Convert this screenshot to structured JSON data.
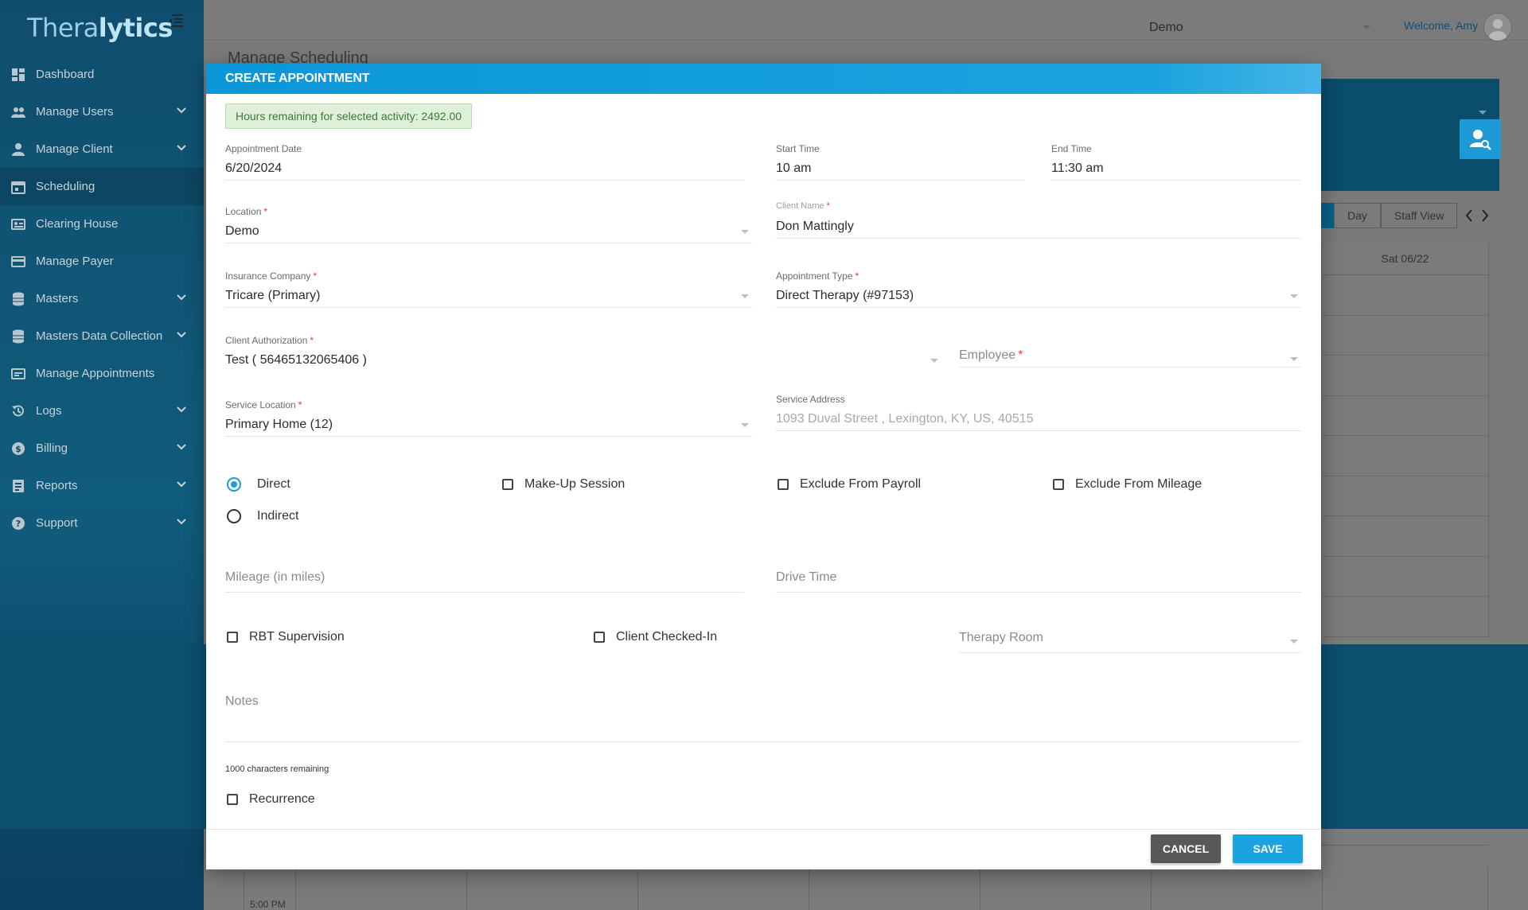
{
  "sidebar": {
    "logo": {
      "part1": "Thera",
      "part2": "lytics"
    },
    "items": [
      {
        "label": "Dashboard",
        "icon": "dashboard-icon",
        "expandable": false
      },
      {
        "label": "Manage Users",
        "icon": "users-icon",
        "expandable": true
      },
      {
        "label": "Manage Client",
        "icon": "person-icon",
        "expandable": true
      },
      {
        "label": "Scheduling",
        "icon": "calendar-icon",
        "expandable": false,
        "active": true
      },
      {
        "label": "Clearing House",
        "icon": "id-card-icon",
        "expandable": false
      },
      {
        "label": "Manage Payer",
        "icon": "payer-icon",
        "expandable": false
      },
      {
        "label": "Masters",
        "icon": "database-icon",
        "expandable": true
      },
      {
        "label": "Masters Data Collection",
        "icon": "database-icon",
        "expandable": true
      },
      {
        "label": "Manage Appointments",
        "icon": "appointments-icon",
        "expandable": false
      },
      {
        "label": "Logs",
        "icon": "history-icon",
        "expandable": true
      },
      {
        "label": "Billing",
        "icon": "dollar-icon",
        "expandable": true
      },
      {
        "label": "Reports",
        "icon": "report-icon",
        "expandable": true
      },
      {
        "label": "Support",
        "icon": "help-icon",
        "expandable": true
      }
    ]
  },
  "topbar": {
    "location": "Demo",
    "welcome": "Welcome, Amy"
  },
  "background": {
    "page_title": "Manage Scheduling",
    "views": [
      "Day",
      "Staff View"
    ],
    "day_header": "Sat 06/22",
    "time_label": "5:00 PM"
  },
  "modal": {
    "title": "CREATE APPOINTMENT",
    "hours_alert": "Hours remaining for selected activity: 2492.00",
    "appointment_date": {
      "label": "Appointment Date",
      "value": "6/20/2024"
    },
    "start_time": {
      "label": "Start Time",
      "value": "10 am"
    },
    "end_time": {
      "label": "End Time",
      "value": "11:30 am"
    },
    "location": {
      "label": "Location",
      "value": "Demo"
    },
    "client_name": {
      "label": "Client Name",
      "value": "Don Mattingly"
    },
    "insurance_company": {
      "label": "Insurance Company",
      "value": "Tricare (Primary)"
    },
    "appointment_type": {
      "label": "Appointment Type",
      "value": "Direct Therapy (#97153)"
    },
    "client_authorization": {
      "label": "Client Authorization",
      "value": "Test ( 56465132065406 )"
    },
    "employee": {
      "placeholder": "Employee"
    },
    "service_location": {
      "label": "Service Location",
      "value": "Primary Home (12)"
    },
    "service_address": {
      "label": "Service Address",
      "value": "1093 Duval Street , Lexington, KY, US, 40515"
    },
    "options": {
      "direct": "Direct",
      "indirect": "Indirect",
      "selected": "Direct",
      "make_up": "Make-Up Session",
      "exclude_payroll": "Exclude From Payroll",
      "exclude_mileage": "Exclude From Mileage"
    },
    "mileage": {
      "placeholder": "Mileage (in miles)"
    },
    "drive_time": {
      "placeholder": "Drive Time"
    },
    "rbt_supervision": "RBT Supervision",
    "client_checked_in": "Client Checked-In",
    "therapy_room": {
      "placeholder": "Therapy Room"
    },
    "notes": {
      "placeholder": "Notes",
      "counter": "1000 characters remaining"
    },
    "recurrence": "Recurrence",
    "buttons": {
      "cancel": "CANCEL",
      "save": "SAVE"
    }
  },
  "colors": {
    "accent": "#1aa3de",
    "header_blue": "#0a97d9",
    "sidebar": "#0f4d6d",
    "required": "#e53935",
    "alert_bg": "#dff0d8"
  }
}
